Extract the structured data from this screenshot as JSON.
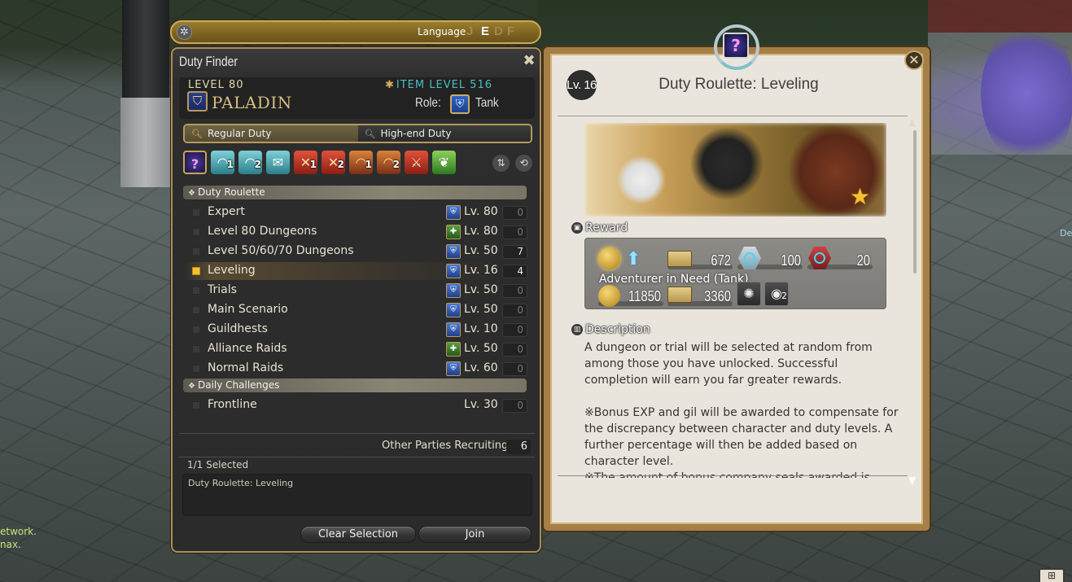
{
  "language_bar": {
    "label": "Language",
    "options": [
      {
        "code": "J",
        "active": false
      },
      {
        "code": "E",
        "active": true
      },
      {
        "code": "D",
        "active": false
      },
      {
        "code": "F",
        "active": false
      }
    ],
    "gear_icon": "gear-icon"
  },
  "duty_finder": {
    "title": "Duty Finder",
    "close_icon": "close-x-icon",
    "character": {
      "level_label": "LEVEL 80",
      "job": "PALADIN",
      "item_level_label": "ITEM LEVEL 516",
      "role_label": "Role:",
      "role": "Tank"
    },
    "tabs": [
      {
        "label": "Regular Duty",
        "active": true,
        "icon": "search-icon"
      },
      {
        "label": "High-end Duty",
        "active": false,
        "icon": "zoom-search-icon"
      }
    ],
    "category_icons": [
      {
        "name": "duty-roulette",
        "glyph": "?",
        "number": "",
        "style": "roulette"
      },
      {
        "name": "dungeons-1",
        "glyph": "◠",
        "number": "1",
        "style": "teal"
      },
      {
        "name": "dungeons-2",
        "glyph": "◠",
        "number": "2",
        "style": "teal"
      },
      {
        "name": "guildhests",
        "glyph": "✉",
        "number": "",
        "style": "teal"
      },
      {
        "name": "trials-1",
        "glyph": "✕",
        "number": "1",
        "style": "red"
      },
      {
        "name": "trials-2",
        "glyph": "✕",
        "number": "2",
        "style": "red"
      },
      {
        "name": "raids-1",
        "glyph": "◠",
        "number": "1",
        "style": "orange"
      },
      {
        "name": "raids-2",
        "glyph": "◠",
        "number": "2",
        "style": "orange"
      },
      {
        "name": "pvp",
        "glyph": "⚔",
        "number": "",
        "style": "red"
      },
      {
        "name": "gold-saucer",
        "glyph": "❦",
        "number": "",
        "style": "green"
      }
    ],
    "sort_icon": "sort-arrows-icon",
    "refresh_icon": "refresh-icon",
    "sections": [
      {
        "title": "Duty Roulette",
        "rows": [
          {
            "name": "Expert",
            "bonus": "blue",
            "level": "Lv. 80",
            "count": "0",
            "selected": false
          },
          {
            "name": "Level 80 Dungeons",
            "bonus": "green",
            "level": "Lv. 80",
            "count": "0",
            "selected": false
          },
          {
            "name": "Level 50/60/70 Dungeons",
            "bonus": "blue",
            "level": "Lv. 50",
            "count": "7",
            "selected": false
          },
          {
            "name": "Leveling",
            "bonus": "blue",
            "level": "Lv. 16",
            "count": "4",
            "selected": true
          },
          {
            "name": "Trials",
            "bonus": "blue",
            "level": "Lv. 50",
            "count": "0",
            "selected": false
          },
          {
            "name": "Main Scenario",
            "bonus": "blue",
            "level": "Lv. 50",
            "count": "0",
            "selected": false
          },
          {
            "name": "Guildhests",
            "bonus": "blue",
            "level": "Lv. 10",
            "count": "0",
            "selected": false
          },
          {
            "name": "Alliance Raids",
            "bonus": "green",
            "level": "Lv. 50",
            "count": "0",
            "selected": false
          },
          {
            "name": "Normal Raids",
            "bonus": "blue",
            "level": "Lv. 60",
            "count": "0",
            "selected": false
          }
        ]
      },
      {
        "title": "Daily Challenges",
        "rows": [
          {
            "name": "Frontline",
            "bonus": "",
            "level": "Lv. 30",
            "count": "0",
            "selected": false
          }
        ]
      }
    ],
    "other_parties_label": "Other Parties Recruiting",
    "other_parties_count": "6",
    "selected_count_label": "1/1 Selected",
    "selected_items": [
      "Duty Roulette: Leveling"
    ],
    "clear_button": "Clear Selection",
    "join_button": "Join"
  },
  "detail": {
    "level_badge": "Lv. 16",
    "title": "Duty Roulette: Leveling",
    "reward_heading": "Reward",
    "rewards": {
      "row1": [
        {
          "item": "gil-bonus",
          "value": ""
        },
        {
          "item": "allied-seals",
          "value": "672"
        },
        {
          "item": "poetics-tomestone",
          "value": "100"
        },
        {
          "item": "allagan-tomestone",
          "value": "20"
        }
      ],
      "adventurer_in_need": "Adventurer in Need (Tank)",
      "row2": [
        {
          "item": "gil",
          "value": "11850"
        },
        {
          "item": "allied-seals",
          "value": "3360"
        },
        {
          "item": "materia-bonus",
          "value": ""
        },
        {
          "item": "cracked-cluster",
          "value": "",
          "count": "2"
        }
      ]
    },
    "description_heading": "Description",
    "description": "A dungeon or trial will be selected at random from among those you have unlocked. Successful completion will earn you far greater rewards.\n\n※Bonus EXP and gil will be awarded to compensate for the discrepancy between character and duty levels. A further percentage will then be added based on character level.\n※The amount of bonus company seals awarded is"
  },
  "background": {
    "chat_lines": [
      "etwork.",
      "nax."
    ],
    "right_edge_text": "De"
  }
}
